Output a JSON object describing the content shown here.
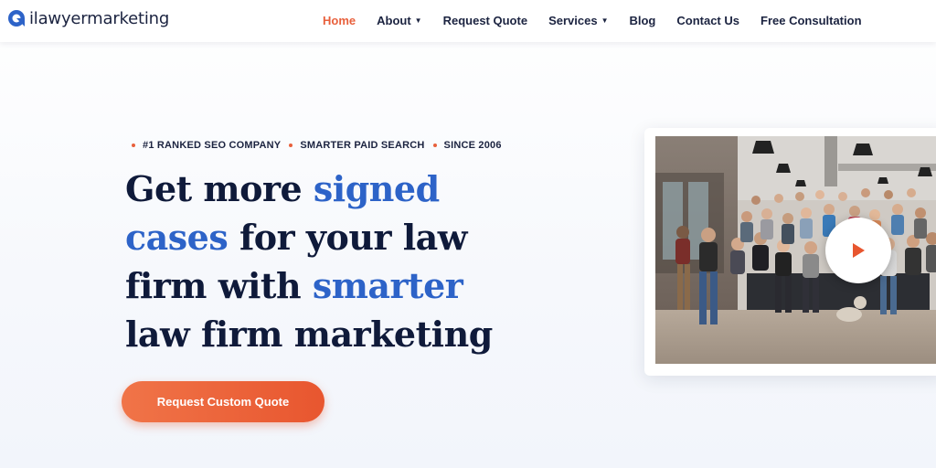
{
  "brand": {
    "name": "ilawyermarketing",
    "accent": "#e8603c",
    "blue": "#2d63c8"
  },
  "nav": {
    "items": [
      {
        "label": "Home",
        "active": true,
        "dropdown": false
      },
      {
        "label": "About",
        "active": false,
        "dropdown": true
      },
      {
        "label": "Request Quote",
        "active": false,
        "dropdown": false
      },
      {
        "label": "Services",
        "active": false,
        "dropdown": true
      },
      {
        "label": "Blog",
        "active": false,
        "dropdown": false
      },
      {
        "label": "Contact Us",
        "active": false,
        "dropdown": false
      },
      {
        "label": "Free Consultation",
        "active": false,
        "dropdown": false
      }
    ]
  },
  "hero": {
    "tags": [
      "#1 RANKED SEO COMPANY",
      "SMARTER PAID SEARCH",
      "SINCE 2006"
    ],
    "headline": {
      "part1": "Get more ",
      "highlight1": "signed cases",
      "part2": " for your law firm with ",
      "highlight2": "smarter",
      "part3": " law firm marketing"
    },
    "cta_label": "Request Custom Quote"
  },
  "video": {
    "play_icon": "play-icon"
  }
}
